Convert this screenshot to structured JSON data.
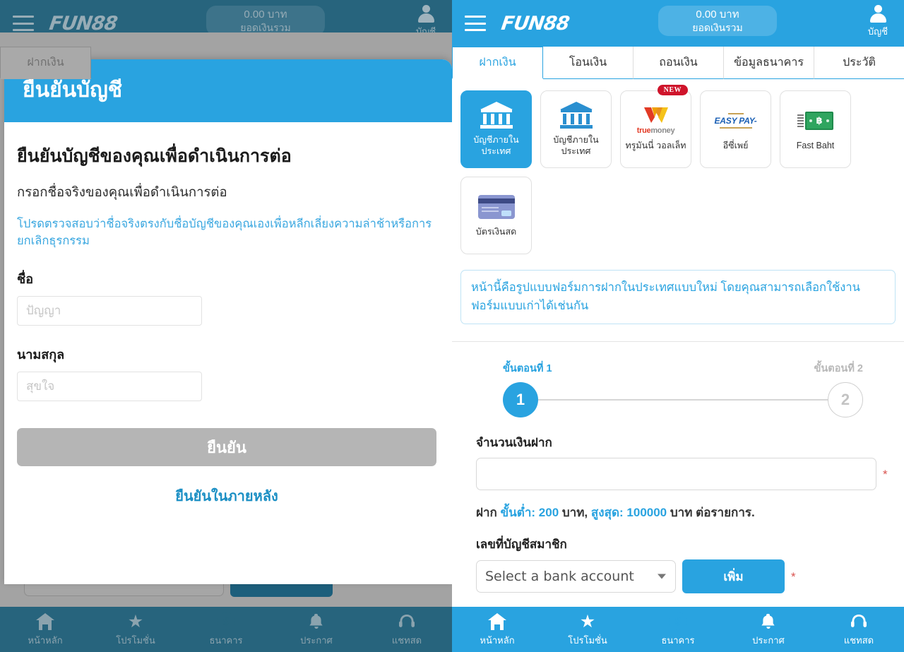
{
  "colors": {
    "brand_blue": "#29a3e0",
    "dim_blue": "#27647d",
    "dim_grey": "#a3a3a3",
    "badge_red": "#cf142b",
    "required_red": "#d9534f",
    "disabled_grey": "#b5b5b5"
  },
  "header": {
    "brand": "FUN88",
    "balance_amount": "0.00 บาท",
    "balance_label": "ยอดเงินรวม",
    "account_label": "บัญชี",
    "menu_icon": "hamburger-menu-icon",
    "avatar_icon": "user-avatar-icon"
  },
  "tabs": [
    {
      "label": "ฝากเงิน",
      "active": true
    },
    {
      "label": "โอนเงิน",
      "active": false
    },
    {
      "label": "ถอนเงิน",
      "active": false
    },
    {
      "label": "ข้อมูลธนาคาร",
      "active": false
    },
    {
      "label": "ประวัติ",
      "active": false
    }
  ],
  "payment_methods": [
    {
      "label": "บัญชีภายในประเทศ",
      "icon": "bank-building-icon",
      "selected": true,
      "badge": ""
    },
    {
      "label": "บัญชีภายในประเทศ",
      "icon": "bank-building-icon",
      "selected": false,
      "badge": ""
    },
    {
      "label": "ทรูมันนี่ วอลเล็ท",
      "icon": "truemoney-wallet-logo",
      "selected": false,
      "badge": "NEW",
      "logo_text_bold": "true",
      "logo_text_light": "money"
    },
    {
      "label": "อีซี่เพย์",
      "icon": "easypay-logo",
      "selected": false,
      "badge": "",
      "logo_text": "EASY PAY-"
    },
    {
      "label": "Fast Baht",
      "icon": "banknote-icon",
      "selected": false,
      "badge": "",
      "logo_symbol": "฿"
    },
    {
      "label": "บัตรเงินสด",
      "icon": "cash-card-icon",
      "selected": false,
      "badge": ""
    }
  ],
  "notice": "หน้านี้คือรูปแบบฟอร์มการฝากในประเทศแบบใหม่ โดยคุณสามารถเลือกใช้งานฟอร์มแบบเก่าได้เช่นกัน",
  "stepper": {
    "step1_label": "ขั้นตอนที่ 1",
    "step2_label": "ขั้นตอนที่ 2",
    "step1_number": "1",
    "step2_number": "2",
    "current": 1
  },
  "deposit_form": {
    "amount_label": "จำนวนเงินฝาก",
    "amount_value": "",
    "amount_placeholder": "",
    "required_mark": "*",
    "limit_prefix": "ฝาก",
    "limit_min_label": "ขั้นต่ำ:",
    "limit_min_value": "200",
    "limit_min_unit": "บาท,",
    "limit_max_label": "สูงสุด:",
    "limit_max_value": "100000",
    "limit_max_unit": "บาท",
    "limit_suffix": "ต่อรายการ.",
    "account_label": "เลขที่บัญชีสมาชิก",
    "account_select_value": "Select a bank account",
    "account_select_caret": "chevron-down-icon",
    "add_button_label": "เพิ่ม"
  },
  "bottom_nav": [
    {
      "label": "หน้าหลัก",
      "icon": "home-icon",
      "glyph": ""
    },
    {
      "label": "โปรโมชั่น",
      "icon": "star-icon",
      "glyph": "★"
    },
    {
      "label": "ธนาคาร",
      "icon": "dollar-coin-icon",
      "glyph": "$"
    },
    {
      "label": "ประกาศ",
      "icon": "bell-icon",
      "glyph": "🔔"
    },
    {
      "label": "แชทสด",
      "icon": "headset-icon",
      "glyph": "🎧"
    }
  ],
  "modal": {
    "header_title": "ยืนยันบัญชี",
    "title": "ยืนยันบัญชีของคุณเพื่อดำเนินการต่อ",
    "subtitle": "กรอกชื่อจริงของคุณเพื่อดำเนินการต่อ",
    "warning": "โปรดตรวจสอบว่าชื่อจริงตรงกับชื่อบัญชีของคุณเองเพื่อหลีกเลี่ยงความล่าช้าหรือการยกเลิกธุรกรรม",
    "firstname_label": "ชื่อ",
    "firstname_value": "",
    "firstname_placeholder": "ปัญญา",
    "lastname_label": "นามสกุล",
    "lastname_value": "",
    "lastname_placeholder": "สุขใจ",
    "confirm_button": "ยืนยัน",
    "later_link": "ยืนยันในภายหลัง"
  }
}
